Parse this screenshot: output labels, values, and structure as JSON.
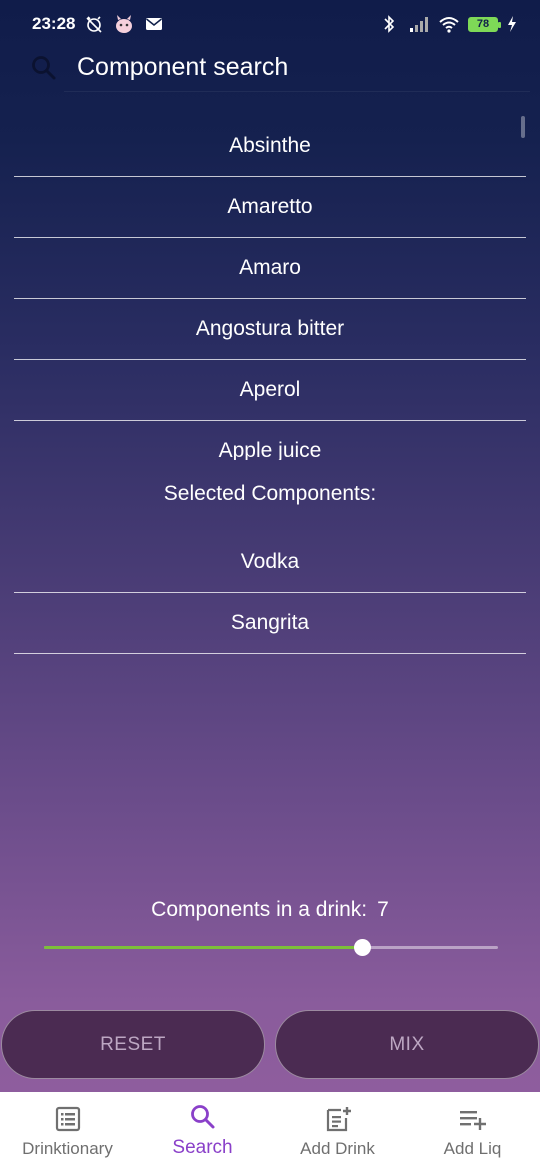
{
  "status_bar": {
    "time": "23:28",
    "battery_level": "78"
  },
  "search": {
    "placeholder": "Component search"
  },
  "components": [
    {
      "label": "Absinthe"
    },
    {
      "label": "Amaretto"
    },
    {
      "label": "Amaro"
    },
    {
      "label": "Angostura bitter"
    },
    {
      "label": "Aperol"
    },
    {
      "label": "Apple juice"
    }
  ],
  "selected": {
    "title": "Selected Components:",
    "items": [
      {
        "label": "Vodka"
      },
      {
        "label": "Sangrita"
      }
    ]
  },
  "count": {
    "label": "Components in a drink:",
    "value": "7",
    "slider_fraction": 0.7
  },
  "actions": {
    "reset_label": "RESET",
    "mix_label": "MIX"
  },
  "nav": {
    "items": [
      {
        "label": "Drinktionary",
        "icon": "list-icon"
      },
      {
        "label": "Search",
        "icon": "search-icon"
      },
      {
        "label": "Add Drink",
        "icon": "note-add-icon"
      },
      {
        "label": "Add Liq",
        "icon": "playlist-add-icon"
      }
    ],
    "active": "Search"
  },
  "colors": {
    "accent": "#8a40c9",
    "slider_fill": "#7dbf3a",
    "battery": "#7ed957"
  }
}
